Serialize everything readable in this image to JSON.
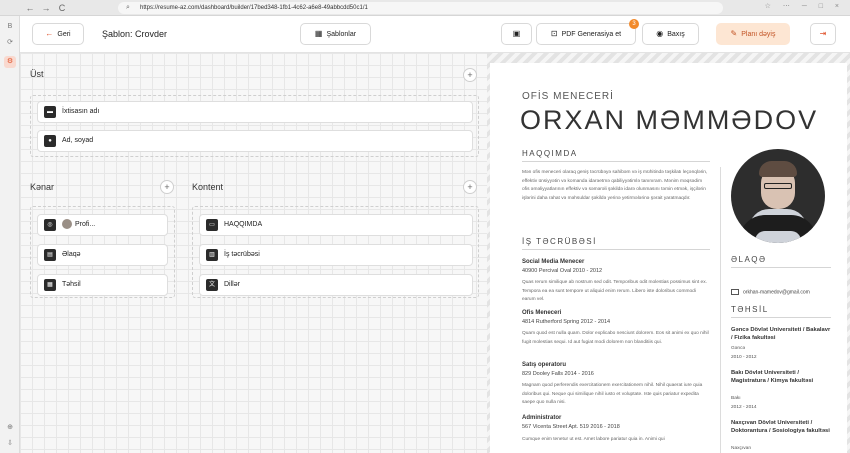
{
  "browser": {
    "url": "https://resume-az.com/dashboard/builder/17bed348-1fb1-4c62-a6e8-49abbcdd50c1/1",
    "back_glyph": "←",
    "forward_glyph": "→",
    "reload_glyph": "C",
    "lock_glyph": "⌕",
    "right_icons": "☆ ⋯ ─ □ ×"
  },
  "strip": {
    "icons": [
      "B",
      "⟳",
      "⚙",
      "⊕",
      "⇩"
    ]
  },
  "toolbar": {
    "back_label": "Geri",
    "back_glyph": "←",
    "template_title": "Şablon: Crovder",
    "templates_label": "Şablonlar",
    "templates_glyph": "▦",
    "doc_glyph": "▣",
    "pdf_label": "PDF Generasiya et",
    "pdf_glyph": "⊡",
    "pdf_badge": "3",
    "view_label": "Baxış",
    "view_glyph": "◉",
    "plan_label": "Planı dəyiş",
    "plan_glyph": "✎",
    "exit_glyph": "⇥"
  },
  "builder": {
    "top_title": "Üst",
    "plus": "+",
    "top_cards": [
      {
        "label": "İxtisasın adı",
        "icon": "▬"
      },
      {
        "label": "Ad, soyad",
        "icon": "●"
      }
    ],
    "side_title": "Kənar",
    "side_cards": [
      {
        "label": "Profi...",
        "icon": "◎"
      },
      {
        "label": "Əlaqə",
        "icon": "▤"
      },
      {
        "label": "Təhsil",
        "icon": "▦"
      }
    ],
    "content_title": "Kontent",
    "content_cards": [
      {
        "label": "HAQQIMDA",
        "icon": "▭"
      },
      {
        "label": "İş təcrübəsi",
        "icon": "▥"
      },
      {
        "label": "Dillər",
        "icon": "文"
      }
    ]
  },
  "resume": {
    "role": "OFİS MENECERİ",
    "name": "ORXAN MƏMMƏDOV",
    "about_title": "HAQQIMDA",
    "about_text": "Mən ofis meneceri olaraq geniş təcrübəyə sahibəm və iş mühitində təşkilatı leçənqlərin, effektiv ünsiyyətin və komanda idarəetmə qabiliyyətimlə tanınıram. Mənim məqsədim ofis əməliyyatlarının effektiv və səmərəli şəkildə idarə olunmasını təmin etmək, işçilərin işlərini daha rahat və məhsuldar şəkildə yerinə yetirmələrinə şərait yaratmaqdır.",
    "work_title": "İŞ TƏCRÜBƏSİ",
    "jobs": [
      {
        "title": "Social Media Menecer",
        "sub": "40900 Percival Oval 2010 - 2012",
        "text": "Quas rerum similique ab nostrum sed odit. Temporibus odit molestias possimus sint ex. Tempora ea ea sunt tempore ut aliquid enim rerum. Libero iste doloribus commodi earum vel."
      },
      {
        "title": "Ofis Meneceri",
        "sub": "4814 Rutherford Spring 2012 - 2014",
        "text": "Quam quod est nulla quam. Dolor explicabo nesciunt dolorem. Eos sit animi ex quo nihil fugit molestias sequi. Id aut fugiat modi dolorem non blanditiis qui."
      },
      {
        "title": "Satış operatoru",
        "sub": "829 Dooley Falls 2014 - 2016",
        "text": "Magnam quod perferendis exercitationem exercitationem nihil. Nihil quaerat iure quia doloribus qui. Neque qui similique nihil iusto et voluptate. Iste quis pariatur expedita saepe quo nulla nisi."
      },
      {
        "title": "Administrator",
        "sub": "567 Vicenta Street Apt. 519 2016 - 2018",
        "text": "Cumque enim tenetur ut est. Amet labore pariatur quia in. Animi qui"
      }
    ],
    "contact_title": "ƏLAQƏ",
    "email": "orkhan-mamedov@gmail.com",
    "edu_title": "TƏHSİL",
    "education": [
      {
        "school": "Gəncə Dövlət Universiteti / Bakalavr / Fizika fakultəsi",
        "city": "Gəncə",
        "years": "2010 - 2012"
      },
      {
        "school": "Bakı Dövlət Universiteti / Magistratura / Kimya fakultəsi",
        "city": "Bakı",
        "years": "2012 - 2014"
      },
      {
        "school": "Naxçıvan Dövlət Universiteti / Doktorantura / Sosiologiya fakultəsi",
        "city": "Naxçıvan",
        "years": ""
      }
    ]
  },
  "colors": {
    "accent": "#e0522b",
    "plan_bg": "#fde6d3",
    "badge": "#f28a2b"
  }
}
